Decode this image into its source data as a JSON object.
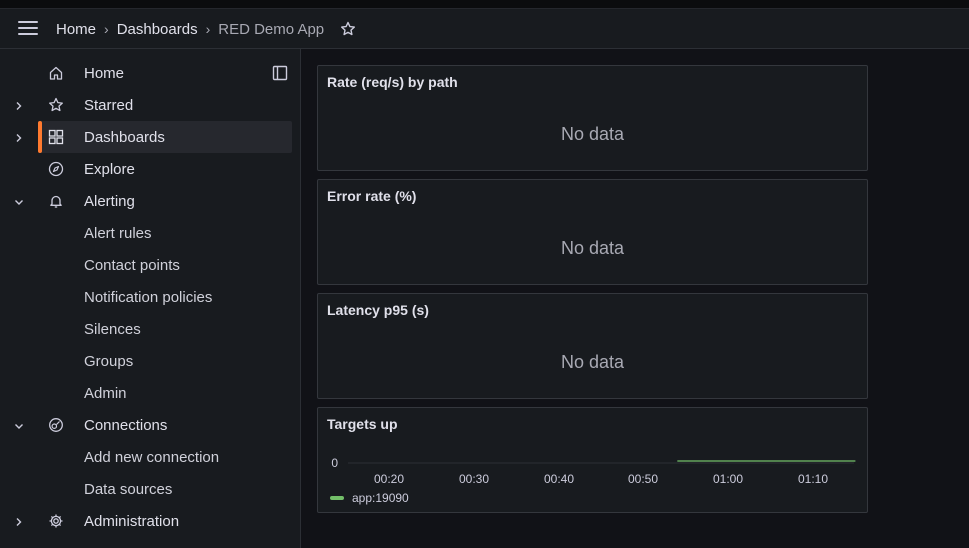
{
  "breadcrumb": {
    "items": [
      "Home",
      "Dashboards"
    ],
    "current": "RED Demo App"
  },
  "sidebar": {
    "items": [
      {
        "label": "Home",
        "icon": "home-icon"
      },
      {
        "label": "Starred",
        "icon": "star-icon"
      },
      {
        "label": "Dashboards",
        "icon": "dashboards-icon"
      },
      {
        "label": "Explore",
        "icon": "compass-icon"
      },
      {
        "label": "Alerting",
        "icon": "bell-icon"
      },
      {
        "label": "Alert rules"
      },
      {
        "label": "Contact points"
      },
      {
        "label": "Notification policies"
      },
      {
        "label": "Silences"
      },
      {
        "label": "Groups"
      },
      {
        "label": "Admin"
      },
      {
        "label": "Connections",
        "icon": "connections-icon"
      },
      {
        "label": "Add new connection"
      },
      {
        "label": "Data sources"
      },
      {
        "label": "Administration",
        "icon": "gear-icon"
      }
    ],
    "active": "Dashboards"
  },
  "panels": [
    {
      "title": "Rate (req/s) by path",
      "message": "No data"
    },
    {
      "title": "Error rate (%)",
      "message": "No data"
    },
    {
      "title": "Latency p95 (s)",
      "message": "No data"
    },
    {
      "title": "Targets up"
    }
  ],
  "chart_data": {
    "type": "line",
    "title": "Targets up",
    "x_ticks": [
      "00:20",
      "00:30",
      "00:40",
      "00:50",
      "01:00",
      "01:10"
    ],
    "y_ticks": [
      "0"
    ],
    "series": [
      {
        "name": "app:19090",
        "color": "#73bf69",
        "x": [
          "00:54",
          "01:15"
        ],
        "y": [
          0,
          0
        ]
      }
    ]
  },
  "colors": {
    "accent": "#ff7a2f",
    "series_green": "#73bf69"
  }
}
